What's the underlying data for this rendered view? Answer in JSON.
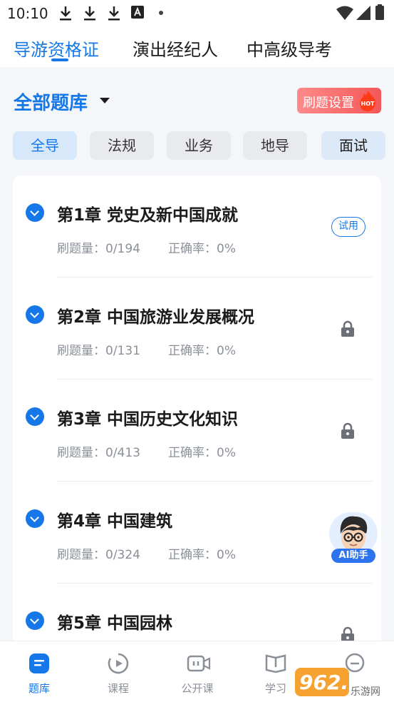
{
  "status_bar": {
    "time": "10:10"
  },
  "top_tabs": [
    {
      "label": "导游资格证",
      "active": true
    },
    {
      "label": "演出经纪人",
      "active": false
    },
    {
      "label": "中高级导考",
      "active": false
    }
  ],
  "header": {
    "bank_title": "全部题库",
    "settings_label": "刷题设置",
    "hot_badge": "HOT"
  },
  "filters": [
    {
      "label": "全导",
      "active": true
    },
    {
      "label": "法规",
      "active": false
    },
    {
      "label": "业务",
      "active": false
    },
    {
      "label": "地导",
      "active": false
    },
    {
      "label": "面试",
      "active": false
    }
  ],
  "chapters": [
    {
      "title": "第1章 党史及新中国成就",
      "count": "刷题量：0/194",
      "rate": "正确率：0%",
      "status": "trial",
      "badge": "试用"
    },
    {
      "title": "第2章 中国旅游业发展概况",
      "count": "刷题量：0/131",
      "rate": "正确率：0%",
      "status": "locked"
    },
    {
      "title": "第3章 中国历史文化知识",
      "count": "刷题量：0/413",
      "rate": "正确率：0%",
      "status": "locked"
    },
    {
      "title": "第4章 中国建筑",
      "count": "刷题量：0/324",
      "rate": "正确率：0%",
      "status": "locked"
    },
    {
      "title": "第5章 中国园林",
      "status": "locked"
    }
  ],
  "ai_helper": {
    "label": "AI助手"
  },
  "bottom_nav": [
    {
      "label": "题库",
      "icon": "question-bank-icon",
      "active": true
    },
    {
      "label": "课程",
      "icon": "play-course-icon",
      "active": false
    },
    {
      "label": "公开课",
      "icon": "video-camera-icon",
      "active": false
    },
    {
      "label": "学习",
      "icon": "book-icon",
      "active": false
    },
    {
      "label": "",
      "icon": "message-icon",
      "active": false
    }
  ],
  "watermark": {
    "text": "962.NET",
    "subtext": "乐游网"
  },
  "colors": {
    "accent": "#1677e8",
    "settings": "#f45757",
    "hot": "#ff4d1a"
  }
}
